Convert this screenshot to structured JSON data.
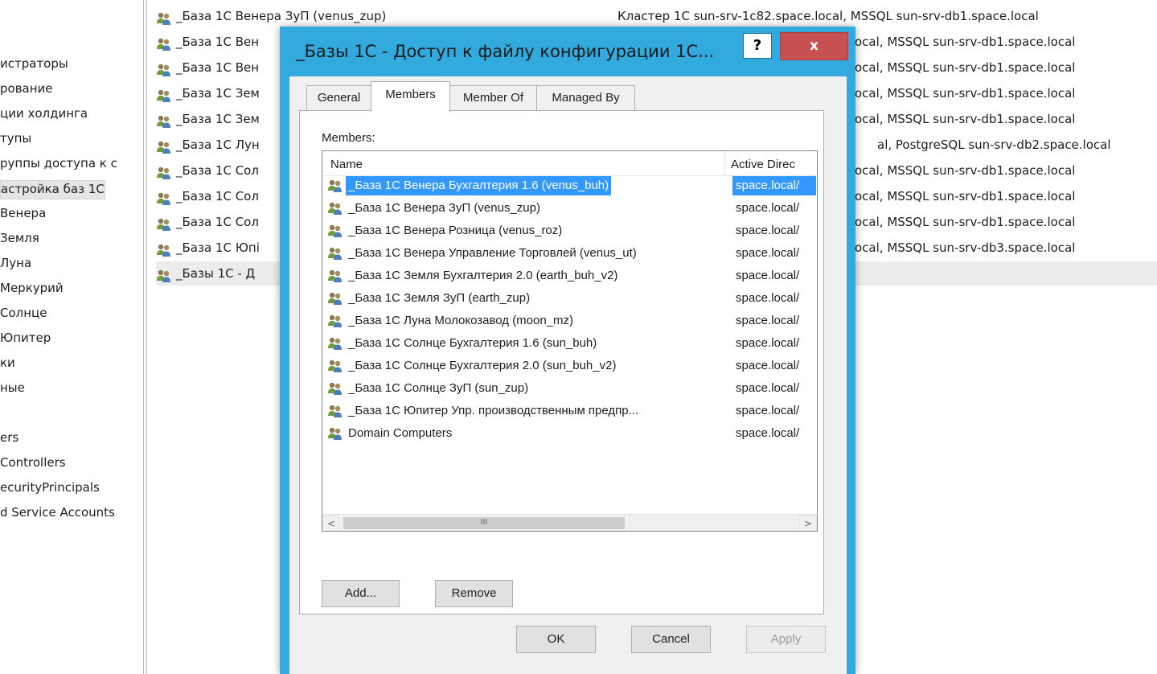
{
  "tree": {
    "items": [
      {
        "label": "истраторы"
      },
      {
        "label": "рование"
      },
      {
        "label": "ции холдинга"
      },
      {
        "label": "тупы"
      },
      {
        "label": "руппы доступа к с"
      },
      {
        "label": "астройка баз 1С",
        "selected": true
      },
      {
        "label": " Венера"
      },
      {
        "label": " Земля"
      },
      {
        "label": " Луна"
      },
      {
        "label": " Меркурий"
      },
      {
        "label": " Солнце"
      },
      {
        "label": " Юпитер"
      },
      {
        "label": "ки"
      },
      {
        "label": "ные"
      },
      {
        "label": ""
      },
      {
        "label": "ers"
      },
      {
        "label": " Controllers"
      },
      {
        "label": "ecurityPrincipals"
      },
      {
        "label": "d Service Accounts"
      }
    ]
  },
  "list": {
    "rows": [
      {
        "name": "_База 1С Венера ЗуП (venus_zup)",
        "info": "Кластер 1С sun-srv-1c82.space.local, MSSQL sun-srv-db1.space.local"
      },
      {
        "name": "_База 1С Вен",
        "info": "ocal, MSSQL sun-srv-db1.space.local"
      },
      {
        "name": "_База 1С Вен",
        "info": "ocal, MSSQL sun-srv-db1.space.local"
      },
      {
        "name": "_База 1С Зем",
        "info": "ocal, MSSQL sun-srv-db1.space.local"
      },
      {
        "name": "_База 1С Зем",
        "info": "ocal, MSSQL sun-srv-db1.space.local"
      },
      {
        "name": "_База 1С Лун",
        "info": "al, PostgreSQL sun-srv-db2.space.local"
      },
      {
        "name": "_База 1С Сол",
        "info": "ocal, MSSQL sun-srv-db1.space.local"
      },
      {
        "name": "_База 1С Сол",
        "info": "ocal, MSSQL sun-srv-db1.space.local"
      },
      {
        "name": "_База 1С Сол",
        "info": "ocal, MSSQL sun-srv-db1.space.local"
      },
      {
        "name": "_База 1С Юпі",
        "info": "ocal, MSSQL sun-srv-db3.space.local"
      },
      {
        "name": "_Базы 1С - Д",
        "info": "",
        "selected": true
      }
    ]
  },
  "dialog": {
    "title": "_Базы 1С - Доступ к файлу конфигурации 1С...",
    "help_label": "?",
    "close_label": "x",
    "tabs": [
      {
        "label": "General"
      },
      {
        "label": "Members",
        "active": true
      },
      {
        "label": "Member Of"
      },
      {
        "label": "Managed By"
      }
    ],
    "members_label": "Members:",
    "columns": {
      "name": "Name",
      "path": "Active Direc"
    },
    "members": [
      {
        "name": "_База 1С Венера Бухгалтерия 1.6 (venus_buh)",
        "path": "space.local/",
        "selected": true
      },
      {
        "name": "_База 1С Венера ЗуП (venus_zup)",
        "path": "space.local/"
      },
      {
        "name": "_База 1С Венера Розница (venus_roz)",
        "path": "space.local/"
      },
      {
        "name": "_База 1С Венера Управление Торговлей (venus_ut)",
        "path": "space.local/"
      },
      {
        "name": "_База 1С Земля Бухгалтерия 2.0 (earth_buh_v2)",
        "path": "space.local/"
      },
      {
        "name": "_База 1С Земля ЗуП (earth_zup)",
        "path": "space.local/"
      },
      {
        "name": "_База 1С Луна Молокозавод (moon_mz)",
        "path": "space.local/"
      },
      {
        "name": "_База 1С Солнце Бухгалтерия 1.6 (sun_buh)",
        "path": "space.local/"
      },
      {
        "name": "_База 1С Солнце Бухгалтерия 2.0 (sun_buh_v2)",
        "path": "space.local/"
      },
      {
        "name": "_База 1С Солнце ЗуП (sun_zup)",
        "path": "space.local/"
      },
      {
        "name": "_База 1С Юпитер Упр. производственным предпр...",
        "path": "space.local/"
      },
      {
        "name": "Domain Computers",
        "path": "space.local/"
      }
    ],
    "scroll": {
      "left": "<",
      "right": ">",
      "thumb": "III"
    },
    "buttons": {
      "add": "Add...",
      "remove": "Remove",
      "ok": "OK",
      "cancel": "Cancel",
      "apply": "Apply"
    }
  },
  "colors": {
    "accent": "#33aadd",
    "close": "#c75050",
    "selection": "#3399ff"
  }
}
